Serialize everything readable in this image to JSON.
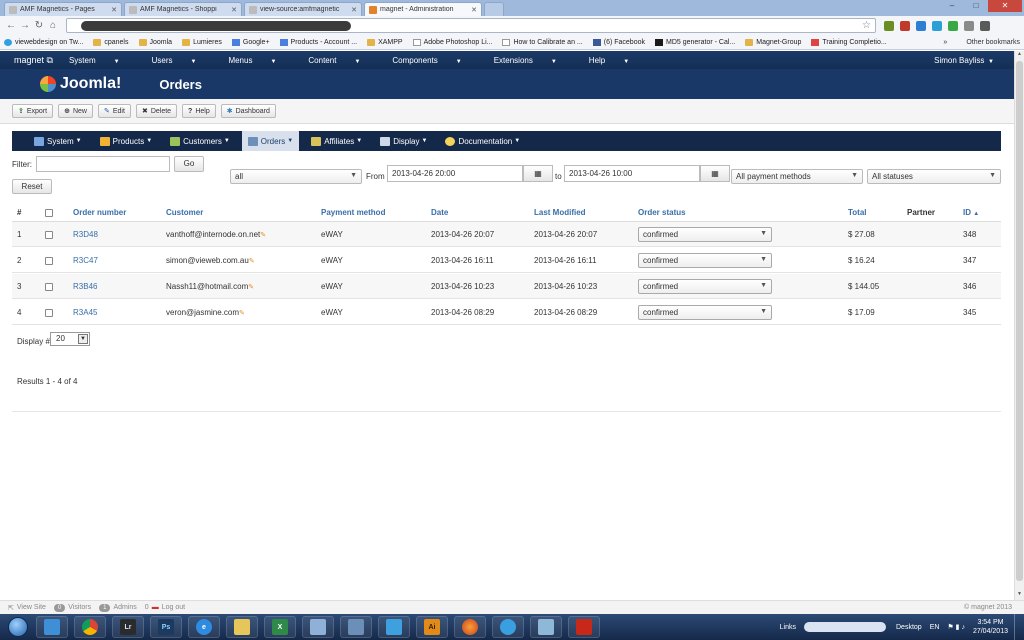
{
  "browser": {
    "tabs": [
      {
        "label": "AMF Magnetics - Pages",
        "active": false
      },
      {
        "label": "AMF Magnetics - Shoppi",
        "active": false
      },
      {
        "label": "view-source:amfmagnetic",
        "active": false
      },
      {
        "label": "magnet - Administration",
        "active": true
      }
    ],
    "bookmarks": [
      {
        "label": "viewebdesign on Tw...",
        "icon": "bird-icon"
      },
      {
        "label": "cpanels",
        "icon": "folder-icon"
      },
      {
        "label": "Joomla",
        "icon": "folder-icon"
      },
      {
        "label": "Lumieres",
        "icon": "folder-icon"
      },
      {
        "label": "Google+",
        "icon": "google-icon"
      },
      {
        "label": "Products - Account ...",
        "icon": "google-icon"
      },
      {
        "label": "XAMPP",
        "icon": "folder-icon"
      },
      {
        "label": "Adobe Photoshop Li...",
        "icon": "page-icon"
      },
      {
        "label": "How to Calibrate an ...",
        "icon": "page-icon"
      },
      {
        "label": "(6) Facebook",
        "icon": "facebook-icon"
      },
      {
        "label": "MD5 generator - Cal...",
        "icon": "page-icon"
      },
      {
        "label": "Magnet-Group",
        "icon": "folder-icon"
      },
      {
        "label": "Training Completio...",
        "icon": "page-icon"
      }
    ],
    "more_bookmarks": "»",
    "other_bookmarks": "Other bookmarks"
  },
  "joomla": {
    "site_name": "magnet",
    "menu": [
      "System",
      "Users",
      "Menus",
      "Content",
      "Components",
      "Extensions",
      "Help"
    ],
    "user": "Simon Bayliss",
    "logo_text": "Joomla!",
    "page_title": "Orders"
  },
  "toolbar": {
    "export": "Export",
    "new": "New",
    "edit": "Edit",
    "delete": "Delete",
    "help": "Help",
    "dashboard": "Dashboard"
  },
  "vm_nav": [
    {
      "label": "System",
      "color": "#7aa6e0",
      "active": false
    },
    {
      "label": "Products",
      "color": "#f2b233",
      "active": false
    },
    {
      "label": "Customers",
      "color": "#9cc25a",
      "active": false
    },
    {
      "label": "Orders",
      "color": "#6e8fb8",
      "active": true
    },
    {
      "label": "Affiliates",
      "color": "#d8c25a",
      "active": false
    },
    {
      "label": "Display",
      "color": "#cfd8e6",
      "active": false
    },
    {
      "label": "Documentation",
      "color": "#f2d45c",
      "active": false
    }
  ],
  "filters": {
    "filter_label": "Filter:",
    "filter_value": "",
    "go": "Go",
    "reset": "Reset",
    "period": "all",
    "from_label": "From",
    "from_date": "2013-04-26 20:00",
    "to_label": "to",
    "to_date": "2013-04-26 10:00",
    "payment": "All payment methods",
    "status": "All statuses"
  },
  "table": {
    "headers": {
      "num": "#",
      "order_number": "Order number",
      "customer": "Customer",
      "payment": "Payment method",
      "date": "Date",
      "last_modified": "Last Modified",
      "status": "Order status",
      "total": "Total",
      "partner": "Partner",
      "id": "ID"
    },
    "sort_indicator": "▲",
    "rows": [
      {
        "num": "1",
        "order": "R3D48",
        "customer": "vanthoff@internode.on.net",
        "payment": "eWAY",
        "date": "2013-04-26 20:07",
        "modified": "2013-04-26 20:07",
        "status": "confirmed",
        "total": "$ 27.08",
        "partner": "",
        "id": "348"
      },
      {
        "num": "2",
        "order": "R3C47",
        "customer": "simon@vieweb.com.au",
        "payment": "eWAY",
        "date": "2013-04-26 16:11",
        "modified": "2013-04-26 16:11",
        "status": "confirmed",
        "total": "$ 16.24",
        "partner": "",
        "id": "347"
      },
      {
        "num": "3",
        "order": "R3B46",
        "customer": "Nassh11@hotmail.com",
        "payment": "eWAY",
        "date": "2013-04-26 10:23",
        "modified": "2013-04-26 10:23",
        "status": "confirmed",
        "total": "$ 144.05",
        "partner": "",
        "id": "346"
      },
      {
        "num": "4",
        "order": "R3A45",
        "customer": "veron@jasmine.com",
        "payment": "eWAY",
        "date": "2013-04-26 08:29",
        "modified": "2013-04-26 08:29",
        "status": "confirmed",
        "total": "$ 17.09",
        "partner": "",
        "id": "345"
      }
    ]
  },
  "pagination": {
    "display_label": "Display #",
    "display_value": "20",
    "results": "Results 1 - 4 of 4"
  },
  "statusbar": {
    "view_site": "View Site",
    "visitors_count": "0",
    "visitors": "Visitors",
    "admins_count": "1",
    "admins": "Admins",
    "logout_count": "0",
    "logout": "Log out",
    "copyright": "© magnet 2013"
  },
  "taskbar": {
    "links": "Links",
    "desktop": "Desktop",
    "lang": "EN",
    "time": "3:54 PM",
    "date": "27/04/2013",
    "apps": [
      {
        "name": "explorer-icon",
        "label": "",
        "color": "#3f8fd6"
      },
      {
        "name": "chrome-icon",
        "label": "",
        "color": "#e0b12f"
      },
      {
        "name": "lightroom-icon",
        "label": "Lr",
        "color": "#2b2b2b"
      },
      {
        "name": "photoshop-icon",
        "label": "Ps",
        "color": "#1b3a5f"
      },
      {
        "name": "ie-icon",
        "label": "e",
        "color": "#2f8be0"
      },
      {
        "name": "folder-icon",
        "label": "",
        "color": "#e6c55a"
      },
      {
        "name": "excel-icon",
        "label": "X",
        "color": "#2f8a4a"
      },
      {
        "name": "notepad-icon",
        "label": "",
        "color": "#8fb1d8"
      },
      {
        "name": "window-icon",
        "label": "",
        "color": "#6c8fb8"
      },
      {
        "name": "twitter-icon",
        "label": "",
        "color": "#3fa0e0"
      },
      {
        "name": "illustrator-icon",
        "label": "Ai",
        "color": "#e08a1a"
      },
      {
        "name": "firefox-icon",
        "label": "",
        "color": "#e06a1a"
      },
      {
        "name": "skype-icon",
        "label": "",
        "color": "#3a9fe0"
      },
      {
        "name": "pen-icon",
        "label": "",
        "color": "#8fb8d8"
      },
      {
        "name": "acrobat-icon",
        "label": "",
        "color": "#c8281a"
      }
    ]
  }
}
